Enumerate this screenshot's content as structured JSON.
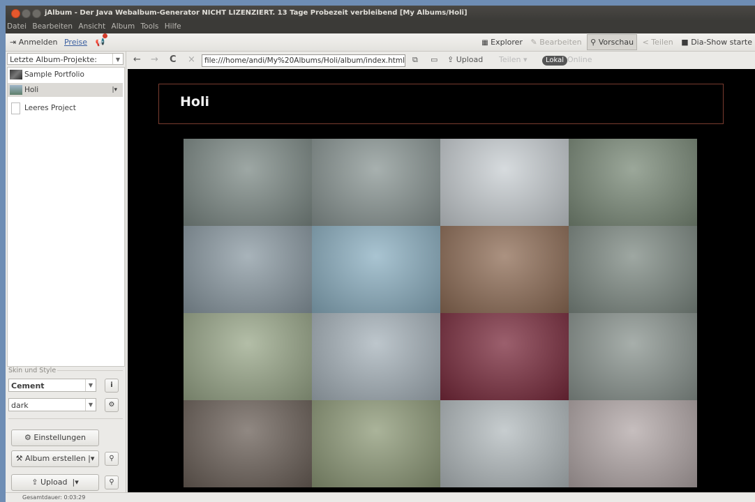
{
  "window": {
    "title": "jAlbum - Der Java Webalbum-Generator NICHT LIZENZIERT. 13 Tage Probezeit verbleibend [My Albums/Holi]"
  },
  "menu": [
    "Datei",
    "Bearbeiten",
    "Ansicht",
    "Album",
    "Tools",
    "Hilfe"
  ],
  "toolbar": {
    "login_label": "Anmelden",
    "prices_label": "Preise",
    "modes": [
      {
        "label": "Explorer",
        "icon": "grid-icon",
        "state": "normal"
      },
      {
        "label": "Bearbeiten",
        "icon": "pencil-icon",
        "state": "disabled"
      },
      {
        "label": "Vorschau",
        "icon": "magnifier-icon",
        "state": "active"
      },
      {
        "label": "Teilen",
        "icon": "share-icon",
        "state": "disabled"
      },
      {
        "label": "Dia-Show starte",
        "icon": "slideshow-icon",
        "state": "normal"
      }
    ]
  },
  "sidebar": {
    "recent_label": "Letzte Album-Projekte:",
    "projects": [
      {
        "label": "Sample Portfolio",
        "selected": false,
        "icon": "photo-thumb"
      },
      {
        "label": "Holi",
        "selected": true,
        "icon": "photo-thumb"
      },
      {
        "label": "Leeres Project",
        "selected": false,
        "icon": "document-icon"
      }
    ],
    "skin_section_label": "Skin und Style",
    "skin": "Cement",
    "style": "dark",
    "settings_label": "Einstellungen",
    "make_album_label": "Album erstellen",
    "upload_label": "Upload"
  },
  "nav": {
    "url": "file:///home/andi/My%20Albums/Holi/album/index.html",
    "upload_label": "Upload",
    "share_label": "Teilen",
    "lokal_label": "Lokal",
    "online_label": "Online"
  },
  "album": {
    "title": "Holi",
    "photos": [
      {
        "color": "#7d8a86"
      },
      {
        "color": "#8a9694"
      },
      {
        "color": "#c9cfd3"
      },
      {
        "color": "#7a8a78"
      },
      {
        "color": "#8b9aa3"
      },
      {
        "color": "#8cb0c2"
      },
      {
        "color": "#8f6d56"
      },
      {
        "color": "#7e8a83"
      },
      {
        "color": "#9aa88a"
      },
      {
        "color": "#a7b3bb"
      },
      {
        "color": "#7a2a3c"
      },
      {
        "color": "#8a948f"
      },
      {
        "color": "#6b6058"
      },
      {
        "color": "#8e9a78"
      },
      {
        "color": "#b4bcbf"
      },
      {
        "color": "#b3a8a8"
      }
    ]
  },
  "status": {
    "duration_label": "Gesamtdauer: 0:03:29"
  }
}
